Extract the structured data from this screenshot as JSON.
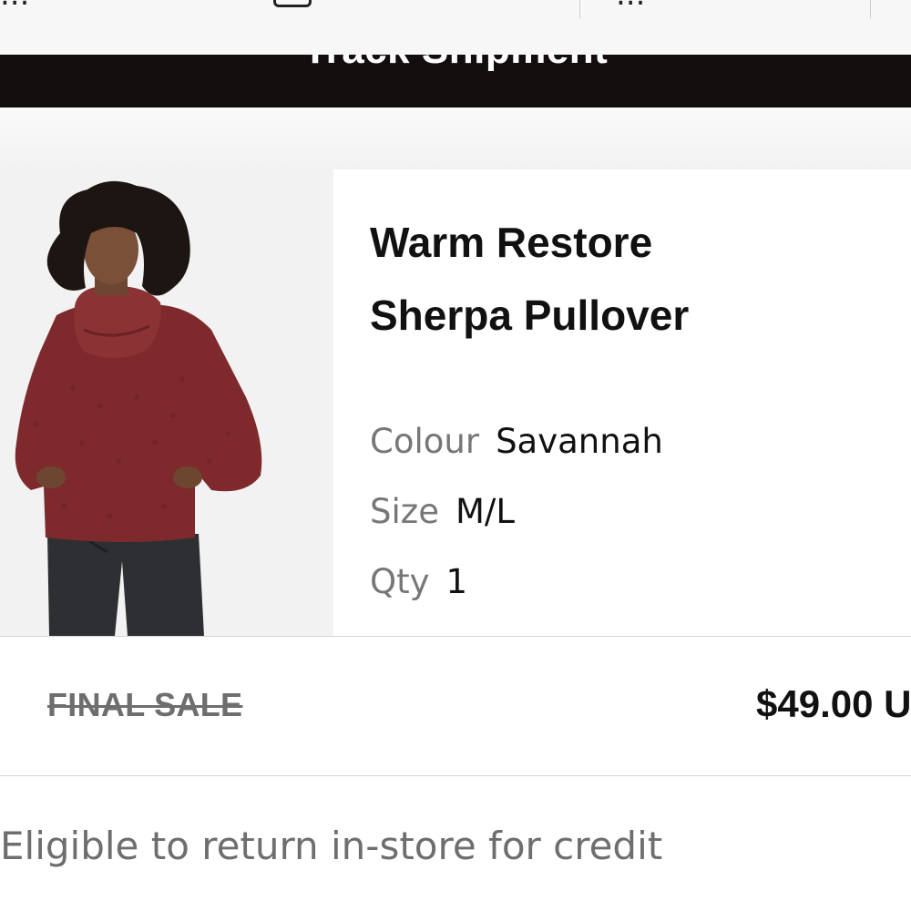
{
  "header": {
    "left_text": "...",
    "right_text": "..."
  },
  "track_shipment": {
    "label": "Track Shipment"
  },
  "product": {
    "name_line1": "Warm Restore",
    "name_line2": "Sherpa Pullover",
    "image_icon": "product-photo",
    "attributes": {
      "colour": {
        "label": "Colour",
        "value": "Savannah"
      },
      "size": {
        "label": "Size",
        "value": "M/L"
      },
      "qty": {
        "label": "Qty",
        "value": "1"
      }
    }
  },
  "sale": {
    "final_sale_label": "FINAL SALE",
    "price": "$49.00 U"
  },
  "return_policy": {
    "text": "Eligible to return in-store for credit"
  },
  "colors": {
    "track_bar_bg": "#130d0e",
    "sweater": "#7e2a2c",
    "muted_text": "#6e6e6e"
  }
}
